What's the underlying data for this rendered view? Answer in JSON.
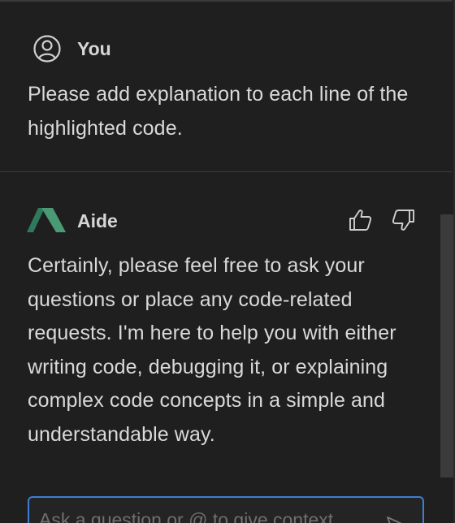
{
  "messages": {
    "user": {
      "author": "You",
      "text": "Please add explanation to each line of the highlighted code.",
      "avatar_icon": "user-circle-icon"
    },
    "aide": {
      "author": "Aide",
      "text": "Certainly, please feel free to ask your questions or place any code-related requests. I'm here to help you with either writing code, debugging it, or explaining complex code concepts in a simple and understandable way.",
      "avatar_icon": "aide-logo-icon",
      "brand_color": "#3f8f6e",
      "feedback": {
        "thumbs_up_icon": "thumbs-up-icon",
        "thumbs_down_icon": "thumbs-down-icon"
      }
    }
  },
  "composer": {
    "placeholder": "Ask a question or @ to give context",
    "send_icon": "send-icon",
    "focus_color": "#3d7fd3"
  }
}
